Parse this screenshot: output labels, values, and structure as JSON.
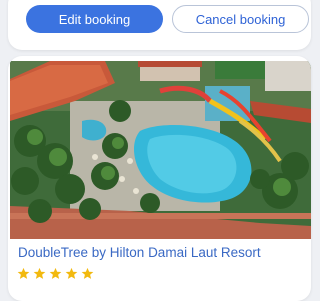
{
  "actions": {
    "edit_label": "Edit booking",
    "cancel_label": "Cancel booking"
  },
  "hotel": {
    "name": "DoubleTree by Hilton Damai Laut Resort",
    "star_rating": 5,
    "star_color": "#f2b90f"
  },
  "colors": {
    "primary": "#3b73e0",
    "link": "#3a69c4",
    "background": "#eef0f4"
  }
}
